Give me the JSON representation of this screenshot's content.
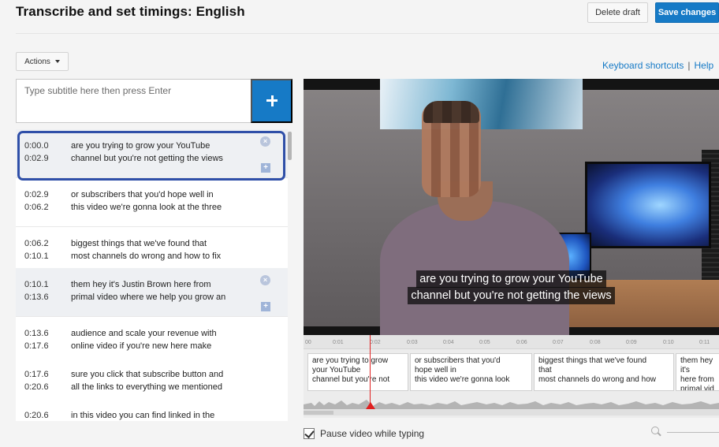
{
  "header": {
    "title": "Transcribe and set timings: English",
    "delete_label": "Delete draft",
    "save_label": "Save changes"
  },
  "toolbar": {
    "actions_label": "Actions",
    "keyboard_shortcuts": "Keyboard shortcuts",
    "separator": "|",
    "help": "Help"
  },
  "input": {
    "placeholder": "Type subtitle here then press Enter",
    "add_icon": "plus-icon"
  },
  "subtitles": [
    {
      "start": "0:00.0",
      "end": "0:02.9",
      "line1": "are you trying to grow your YouTube",
      "line2": "channel but you're not getting the views"
    },
    {
      "start": "0:02.9",
      "end": "0:06.2",
      "line1": "or subscribers that you'd hope well in",
      "line2": "this video we're gonna look at the three"
    },
    {
      "start": "0:06.2",
      "end": "0:10.1",
      "line1": "biggest things that we've found that",
      "line2": "most channels do wrong and how to fix"
    },
    {
      "start": "0:10.1",
      "end": "0:13.6",
      "line1": "them hey it's Justin Brown here from",
      "line2": "primal video where we help you grow an"
    },
    {
      "start": "0:13.6",
      "end": "0:17.6",
      "line1": "audience and scale your revenue with",
      "line2": "online video if you're new here make"
    },
    {
      "start": "0:17.6",
      "end": "0:20.6",
      "line1": "sure you click that subscribe button and",
      "line2": "all the links to everything we mentioned"
    },
    {
      "start": "0:20.6",
      "end": "",
      "line1": "in this video you can find linked in the",
      "line2": ""
    }
  ],
  "video": {
    "caption_line1": "are you trying to grow your YouTube",
    "caption_line2": "channel but you're not getting the views"
  },
  "timeline": {
    "ticks": [
      "00",
      "0:01",
      "0:02",
      "0:03",
      "0:04",
      "0:05",
      "0:06",
      "0:07",
      "0:08",
      "0:09",
      "0:10",
      "0:11"
    ],
    "cues": [
      {
        "l1": "are you trying to grow",
        "l2": "your YouTube",
        "l3": "channel but you're not"
      },
      {
        "l1": "or subscribers that you'd",
        "l2": "hope well in",
        "l3": "this video we're gonna look"
      },
      {
        "l1": "biggest things that we've found",
        "l2": "that",
        "l3": "most channels do wrong and how"
      },
      {
        "l1": "them hey it's",
        "l2": "here from",
        "l3": "primal vid"
      }
    ]
  },
  "footer": {
    "pause_label": "Pause video while typing",
    "pause_checked": true,
    "zoom_icon": "search-icon"
  },
  "colors": {
    "accent": "#167ac6",
    "highlight_border": "#2f4fa8",
    "playhead": "#e02020"
  }
}
